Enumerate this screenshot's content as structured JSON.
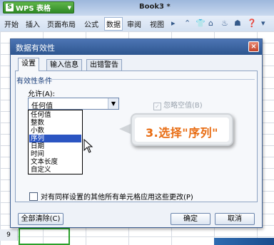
{
  "app": {
    "name": "WPS 表格",
    "logo_letter": "S",
    "document_title": "Book3 *"
  },
  "menu": {
    "items": [
      "开始",
      "插入",
      "页面布局",
      "公式",
      "数据",
      "审阅",
      "视图"
    ],
    "active": "数据"
  },
  "sheet": {
    "visible_row": "9"
  },
  "dialog": {
    "title": "数据有效性",
    "close": "×",
    "tabs": [
      "设置",
      "输入信息",
      "出错警告"
    ],
    "active_tab": "设置",
    "group_label": "有效性条件",
    "allow_label": "允许(A):",
    "allow_value": "任何值",
    "allow_arrow": "▼",
    "ignore_blank": {
      "label": "忽略空值(B)",
      "checked": true,
      "check_mark": "✓",
      "enabled": false
    },
    "options": [
      "任何值",
      "整数",
      "小数",
      "序列",
      "日期",
      "时间",
      "文本长度",
      "自定义"
    ],
    "selected_option": "序列",
    "apply_all_label": "对有同样设置的其他所有单元格应用这些更改(P)",
    "clear_all_label": "全部清除(C)",
    "ok_label": "确定",
    "cancel_label": "取消"
  },
  "callout": {
    "text": "3.选择\"序列\""
  },
  "colors": {
    "accent_green": "#2f8a26",
    "title_blue": "#2d568f",
    "selection_blue": "#2b55c2",
    "callout_orange": "#e86c12"
  },
  "icons": {
    "menu_right": [
      "chevron-up-icon",
      "shirt-icon",
      "home-icon",
      "cake-icon",
      "users-icon",
      "help-icon",
      "chevron-down-icon"
    ]
  }
}
